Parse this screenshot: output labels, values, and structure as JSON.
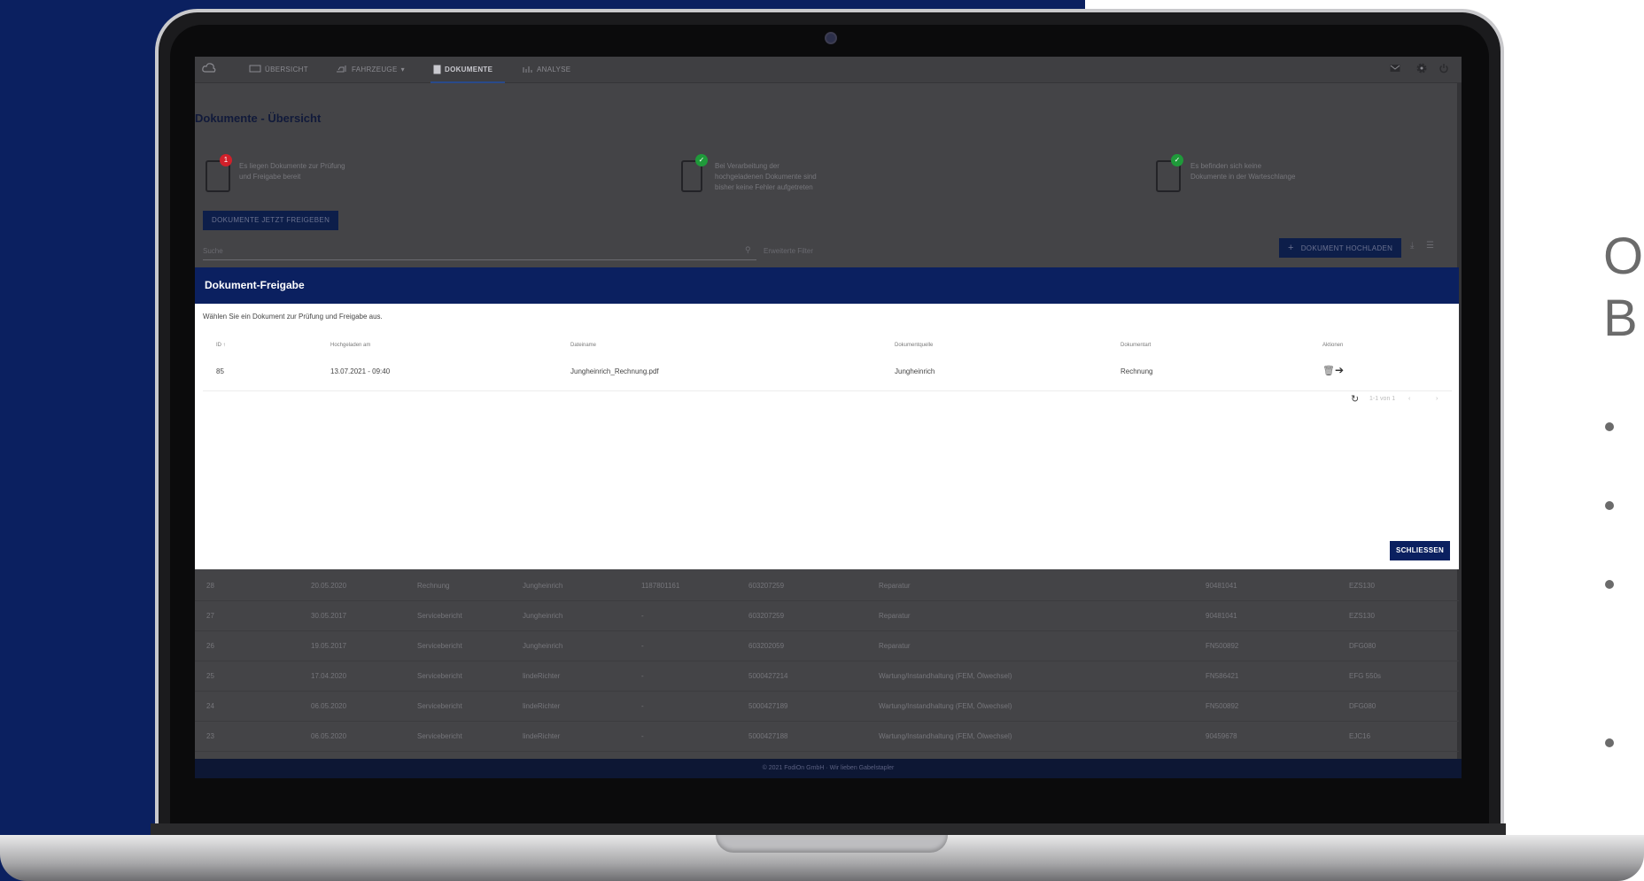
{
  "nav": {
    "items": [
      "ÜBERSICHT",
      "FAHRZEUGE",
      "DOKUMENTE",
      "ANALYSE"
    ],
    "active": "DOKUMENTE"
  },
  "page": {
    "title": "Dokumente - Übersicht",
    "info": [
      {
        "text": "Es liegen Dokumente zur Prüfung und Freigabe bereit",
        "badge": "1"
      },
      {
        "text": "Bei Verarbeitung der hochgeladenen Dokumente sind bisher keine Fehler aufgetreten",
        "badge": ""
      },
      {
        "text": "Es befinden sich keine Dokumente in der Warteschlange",
        "badge": ""
      }
    ],
    "release_button": "DOKUMENTE JETZT FREIGEBEN",
    "search_placeholder": "Suche",
    "extended_filter": "Erweiterte Filter",
    "upload_button": "DOKUMENT HOCHLADEN"
  },
  "modal": {
    "title": "Dokument-Freigabe",
    "description": "Wählen Sie ein Dokument zur Prüfung und Freigabe aus.",
    "columns": [
      "ID",
      "Hochgeladen am",
      "Dateiname",
      "Dokumentquelle",
      "Dokumentart",
      "Aktionen"
    ],
    "rows": [
      {
        "id": "85",
        "uploaded": "13.07.2021 - 09:40",
        "filename": "Jungheinrich_Rechnung.pdf",
        "source": "Jungheinrich",
        "type": "Rechnung"
      }
    ],
    "pager": "1-1 von 1",
    "close_button": "SCHLIESSEN"
  },
  "bg_table": {
    "rows": [
      [
        "28",
        "20.05.2020",
        "Rechnung",
        "Jungheinrich",
        "1187801161",
        "603207259",
        "Reparatur",
        "90481041",
        "EZS130"
      ],
      [
        "27",
        "30.05.2017",
        "Servicebericht",
        "Jungheinrich",
        "-",
        "603207259",
        "Reparatur",
        "90481041",
        "EZS130"
      ],
      [
        "26",
        "19.05.2017",
        "Servicebericht",
        "Jungheinrich",
        "-",
        "603202059",
        "Reparatur",
        "FN500892",
        "DFG080"
      ],
      [
        "25",
        "17.04.2020",
        "Servicebericht",
        "lindeRichter",
        "-",
        "5000427214",
        "Wartung/Instandhaltung (FEM, Ölwechsel)",
        "FN586421",
        "EFG 550s"
      ],
      [
        "24",
        "06.05.2020",
        "Servicebericht",
        "lindeRichter",
        "-",
        "5000427189",
        "Wartung/Instandhaltung (FEM, Ölwechsel)",
        "FN500892",
        "DFG080"
      ],
      [
        "23",
        "06.05.2020",
        "Servicebericht",
        "lindeRichter",
        "-",
        "5000427188",
        "Wartung/Instandhaltung (FEM, Ölwechsel)",
        "90459678",
        "EJC16"
      ]
    ]
  },
  "footer": "© 2021 FodiOn GmbH · Wir lieben Gabelstapler",
  "side": {
    "title_line1": "O",
    "title_line2": "B"
  },
  "colors": {
    "navy": "#0b2060",
    "badge_red": "#d0202a",
    "badge_green": "#1f9a3a"
  }
}
